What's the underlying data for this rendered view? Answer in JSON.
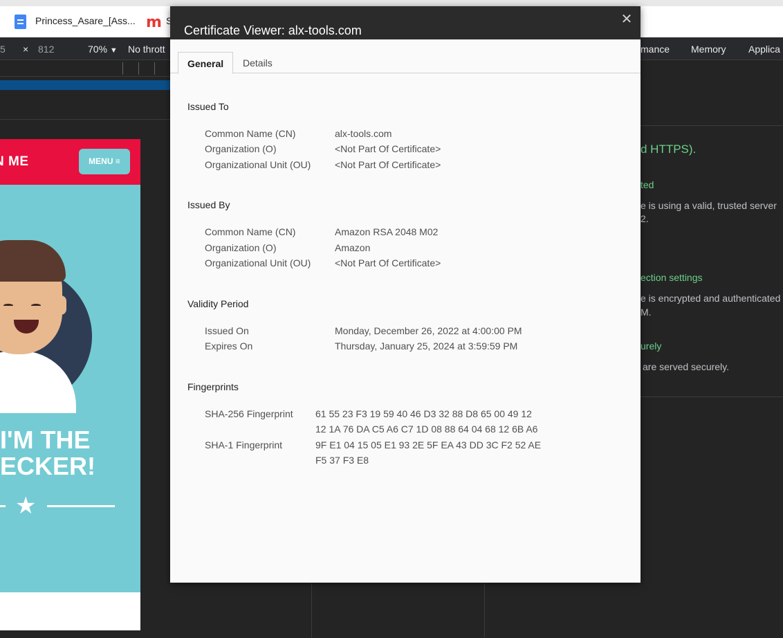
{
  "browser": {
    "bookmarks": [
      {
        "label": "Princess_Asare_[Ass...",
        "icon": "google-docs-icon"
      },
      {
        "label": "S",
        "icon": "m-logo-icon"
      }
    ]
  },
  "devtools": {
    "toolbar": {
      "width_value": "5",
      "times": "×",
      "height_value": "812",
      "zoom": "70%",
      "throttle": "No thrott",
      "tabs": [
        "mance",
        "Memory",
        "Applica"
      ]
    },
    "security_panel": {
      "heading_fragment": "d HTTPS).",
      "items": [
        {
          "title": "ted",
          "lines": [
            "e is using a valid, trusted server",
            "2."
          ]
        },
        {
          "title": "ection settings",
          "lines": [
            "e is encrypted and authenticated",
            "M."
          ]
        },
        {
          "title": "urely",
          "lines": [
            "are served securely."
          ]
        }
      ]
    }
  },
  "mobile_page": {
    "header_title": "N ME",
    "menu_label": "MENU ≡",
    "headline_line1": "I'M THE",
    "headline_line2": "ECKER!",
    "star": "★"
  },
  "certificate": {
    "title": "Certificate Viewer: alx-tools.com",
    "close_glyph": "✕",
    "tabs": [
      {
        "label": "General",
        "active": true
      },
      {
        "label": "Details",
        "active": false
      }
    ],
    "issued_to": {
      "title": "Issued To",
      "fields": [
        {
          "label": "Common Name (CN)",
          "value": "alx-tools.com"
        },
        {
          "label": "Organization (O)",
          "value": "<Not Part Of Certificate>"
        },
        {
          "label": "Organizational Unit (OU)",
          "value": "<Not Part Of Certificate>"
        }
      ]
    },
    "issued_by": {
      "title": "Issued By",
      "fields": [
        {
          "label": "Common Name (CN)",
          "value": "Amazon RSA 2048 M02"
        },
        {
          "label": "Organization (O)",
          "value": "Amazon"
        },
        {
          "label": "Organizational Unit (OU)",
          "value": "<Not Part Of Certificate>"
        }
      ]
    },
    "validity": {
      "title": "Validity Period",
      "fields": [
        {
          "label": "Issued On",
          "value": "Monday, December 26, 2022 at 4:00:00 PM"
        },
        {
          "label": "Expires On",
          "value": "Thursday, January 25, 2024 at 3:59:59 PM"
        }
      ]
    },
    "fingerprints": {
      "title": "Fingerprints",
      "sha256": {
        "label": "SHA-256 Fingerprint",
        "line1": "61 55 23 F3 19 59 40 46 D3 32 88 D8 65 00 49 12",
        "line2": "12 1A 76 DA C5 A6 C7 1D 08 88 64 04 68 12 6B A6"
      },
      "sha1": {
        "label": "SHA-1 Fingerprint",
        "line1": "9F E1 04 15 05 E1 93 2E 5F EA 43 DD 3C F2 52 AE",
        "line2": "F5 37 F3 E8"
      }
    }
  },
  "colors": {
    "accent_red": "#e8103f",
    "hero_teal": "#74cbd3",
    "security_green": "#6bd18a"
  }
}
